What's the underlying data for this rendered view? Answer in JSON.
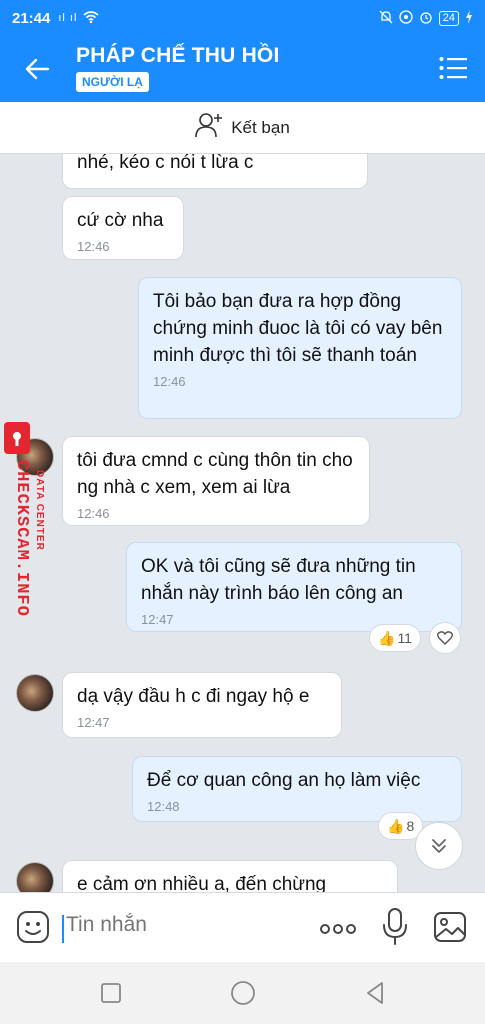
{
  "status": {
    "time": "21:44",
    "signal": "ıl ıl",
    "battery": "24"
  },
  "header": {
    "title": "PHÁP CHẾ THU HỒI",
    "badge": "NGƯỜI LẠ"
  },
  "add_friend": {
    "label": "Kết bạn"
  },
  "messages": [
    {
      "side": "in",
      "text": "nhé, kéo c nói t lừa c",
      "time": ""
    },
    {
      "side": "in",
      "text": "cứ cờ nha",
      "time": "12:46"
    },
    {
      "side": "out",
      "text": "Tôi bảo bạn đưa ra hợp đồng chứng minh đuoc là tôi có vay bên minh được thì tôi sẽ thanh toán",
      "time": "12:46"
    },
    {
      "side": "in",
      "text": "tôi đưa cmnd c cùng thôn tin cho ng nhà c xem, xem ai lừa",
      "time": "12:46"
    },
    {
      "side": "out",
      "text": "OK và tôi cũng sẽ đưa những tin nhắn này trình báo lên công an",
      "time": "12:47",
      "likes": "11"
    },
    {
      "side": "in",
      "text": "dạ vậy đầu h c đi ngay hộ e",
      "time": "12:47"
    },
    {
      "side": "out",
      "text": "Để cơ quan công an họ làm việc",
      "time": "12:48",
      "likes": "8"
    },
    {
      "side": "in",
      "text": "e cảm ơn nhiều a, đến chừng",
      "time": ""
    }
  ],
  "watermark": {
    "brand": "CHECKSCAM.INFO",
    "sub": "DATA CENTER"
  },
  "input": {
    "placeholder": "Tin nhắn"
  },
  "colors": {
    "primary": "#1a8cff",
    "out_bubble": "#e5f1ff",
    "watermark": "#e3262f"
  }
}
